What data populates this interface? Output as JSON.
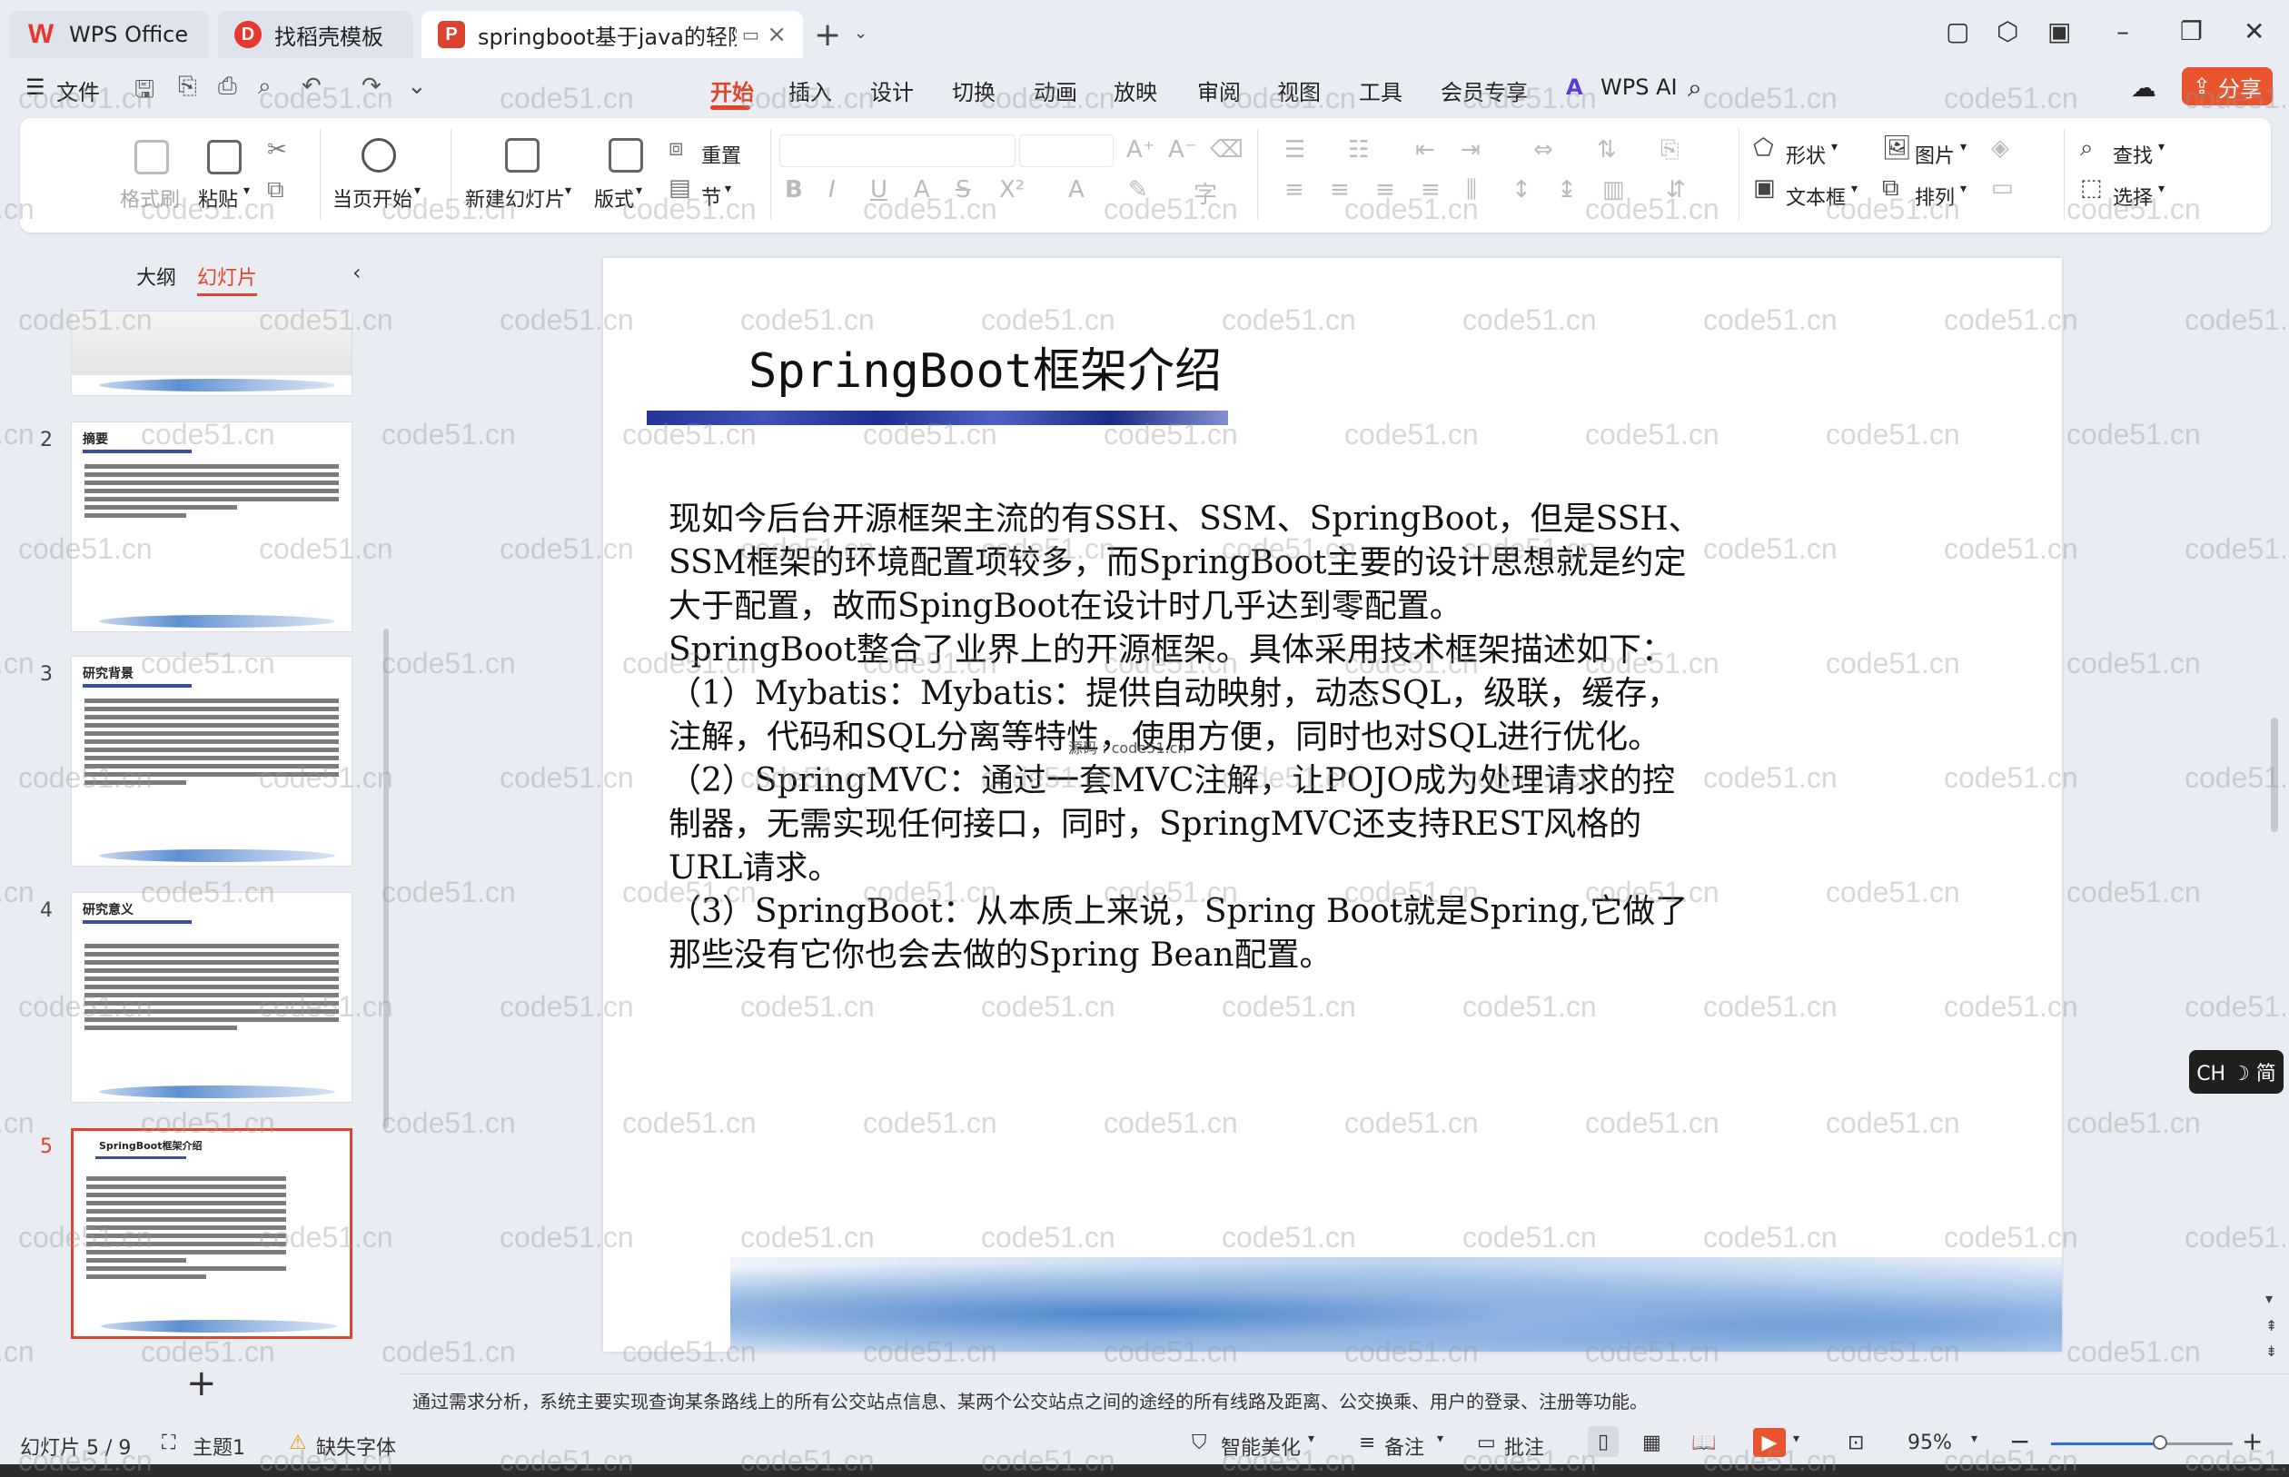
{
  "tabs": {
    "wps": "WPS Office",
    "template": "找稻壳模板",
    "document": "springboot基于java的轻院网"
  },
  "menu": {
    "file": "文件",
    "items": [
      "开始",
      "插入",
      "设计",
      "切换",
      "动画",
      "放映",
      "审阅",
      "视图",
      "工具",
      "会员专享"
    ],
    "active": "开始",
    "wps_ai": "WPS AI",
    "share": "分享"
  },
  "ribbon": {
    "format_painter": "格式刷",
    "paste": "粘贴",
    "from_current": "当页开始",
    "new_slide": "新建幻灯片",
    "layout": "版式",
    "section": "节",
    "reset": "重置",
    "shape": "形状",
    "picture": "图片",
    "find": "查找",
    "textbox": "文本框",
    "arrange": "排列",
    "select": "选择"
  },
  "left_panel": {
    "tab_outline": "大纲",
    "tab_slides": "幻灯片",
    "thumbnails": [
      {
        "num": "2",
        "title": "摘要"
      },
      {
        "num": "3",
        "title": "研究背景"
      },
      {
        "num": "4",
        "title": "研究意义"
      },
      {
        "num": "5",
        "title": "SpringBoot框架介绍"
      }
    ]
  },
  "slide": {
    "title": "SpringBoot框架介绍",
    "paragraphs": [
      "现如今后台开源框架主流的有SSH、SSM、SpringBoot，但是SSH、SSM框架的环境配置项较多，而SpringBoot主要的设计思想就是约定大于配置，故而SpingBoot在设计时几乎达到零配置。",
      "SpringBoot整合了业界上的开源框架。具体采用技术框架描述如下：",
      "（1）Mybatis：Mybatis：提供自动映射，动态SQL，级联，缓存，注解，代码和SQL分离等特性，使用方便，同时也对SQL进行优化。",
      "（2）SpringMVC：通过一套MVC注解，让POJO成为处理请求的控制器，无需实现任何接口，同时，SpringMVC还支持REST风格的URL请求。",
      "（3）SpringBoot：从本质上来说，Spring Boot就是Spring,它做了那些没有它你也会去做的Spring Bean配置。"
    ],
    "source_mark": "源码 : code51.cn"
  },
  "notes": "通过需求分析，系统主要实现查询某条路线上的所有公交站点信息、某两个公交站点之间的途经的所有线路及距离、公交换乘、用户的登录、注册等功能。",
  "status": {
    "slide_counter": "幻灯片 5 / 9",
    "theme": "主题1",
    "missing_font": "缺失字体",
    "smart_beautify": "智能美化",
    "notes": "备注",
    "comment": "批注",
    "zoom": "95%",
    "zoom_level": 0.6
  },
  "ime": "CH ☽ 简",
  "watermark": "code51.cn"
}
